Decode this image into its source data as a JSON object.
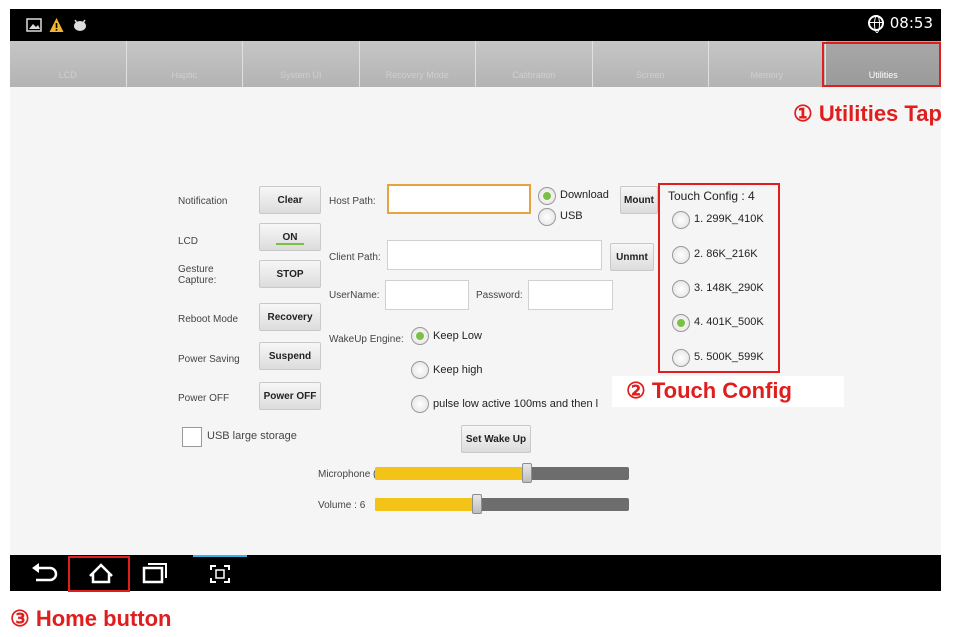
{
  "status_bar": {
    "time": "08:53",
    "icons": [
      "image-icon",
      "warning-icon",
      "android-debug-icon",
      "globe-icon"
    ]
  },
  "tabs": [
    {
      "label": "LCD"
    },
    {
      "label": "Haptic"
    },
    {
      "label": "System UI"
    },
    {
      "label": "Recovery Mode"
    },
    {
      "label": "Calibration"
    },
    {
      "label": "Screen"
    },
    {
      "label": "Memory"
    },
    {
      "label": "Utilities",
      "active": true
    }
  ],
  "callouts": {
    "utilities": "① Utilities Tap",
    "touch_config": "② Touch Config",
    "home_button": "③ Home button"
  },
  "left_panel": {
    "rows": [
      {
        "label": "Notification",
        "button": "Clear"
      },
      {
        "label": "LCD",
        "button": "ON"
      },
      {
        "label": "Gesture\nCapture:",
        "button": "STOP"
      },
      {
        "label": "Reboot Mode",
        "button": "Recovery"
      },
      {
        "label": "Power Saving",
        "button": "Suspend"
      },
      {
        "label": "Power OFF",
        "button": "Power OFF"
      }
    ],
    "usb_storage_label": "USB large storage",
    "usb_storage_checked": false
  },
  "middle_panel": {
    "host_path_label": "Host Path:",
    "host_path_value": "",
    "client_path_label": "Client Path:",
    "client_path_value": "",
    "username_label": "UserName:",
    "username_value": "",
    "password_label": "Password:",
    "password_value": "",
    "mount_options": [
      {
        "label": "Download",
        "selected": true
      },
      {
        "label": "USB",
        "selected": false
      }
    ],
    "mount_button": "Mount",
    "unmount_button": "Unmnt",
    "wakeup_label": "WakeUp Engine:",
    "wakeup_options": [
      {
        "label": "Keep Low",
        "selected": true
      },
      {
        "label": "Keep high",
        "selected": false
      },
      {
        "label": "pulse low active 100ms and then l",
        "selected": false
      }
    ],
    "set_wakeup_button": "Set Wake Up",
    "microphone_label": "Microphone (4)",
    "microphone_level": 0.6,
    "volume_label": "Volume : 6",
    "volume_level": 0.4
  },
  "touch_config": {
    "title": "Touch Config : 4",
    "options": [
      {
        "label": "1. 299K_410K",
        "selected": false
      },
      {
        "label": "2. 86K_216K",
        "selected": false
      },
      {
        "label": "3. 148K_290K",
        "selected": false
      },
      {
        "label": "4. 401K_500K",
        "selected": true
      },
      {
        "label": "5. 500K_599K",
        "selected": false
      }
    ]
  },
  "nav_bar": {
    "buttons": [
      "back-icon",
      "home-icon",
      "recent-apps-icon",
      "screenshot-icon"
    ]
  },
  "colors": {
    "highlight": "#e01e1e",
    "accent_yellow": "#f3c417",
    "radio_green": "#7bc043",
    "host_path_border": "#e8a341"
  }
}
